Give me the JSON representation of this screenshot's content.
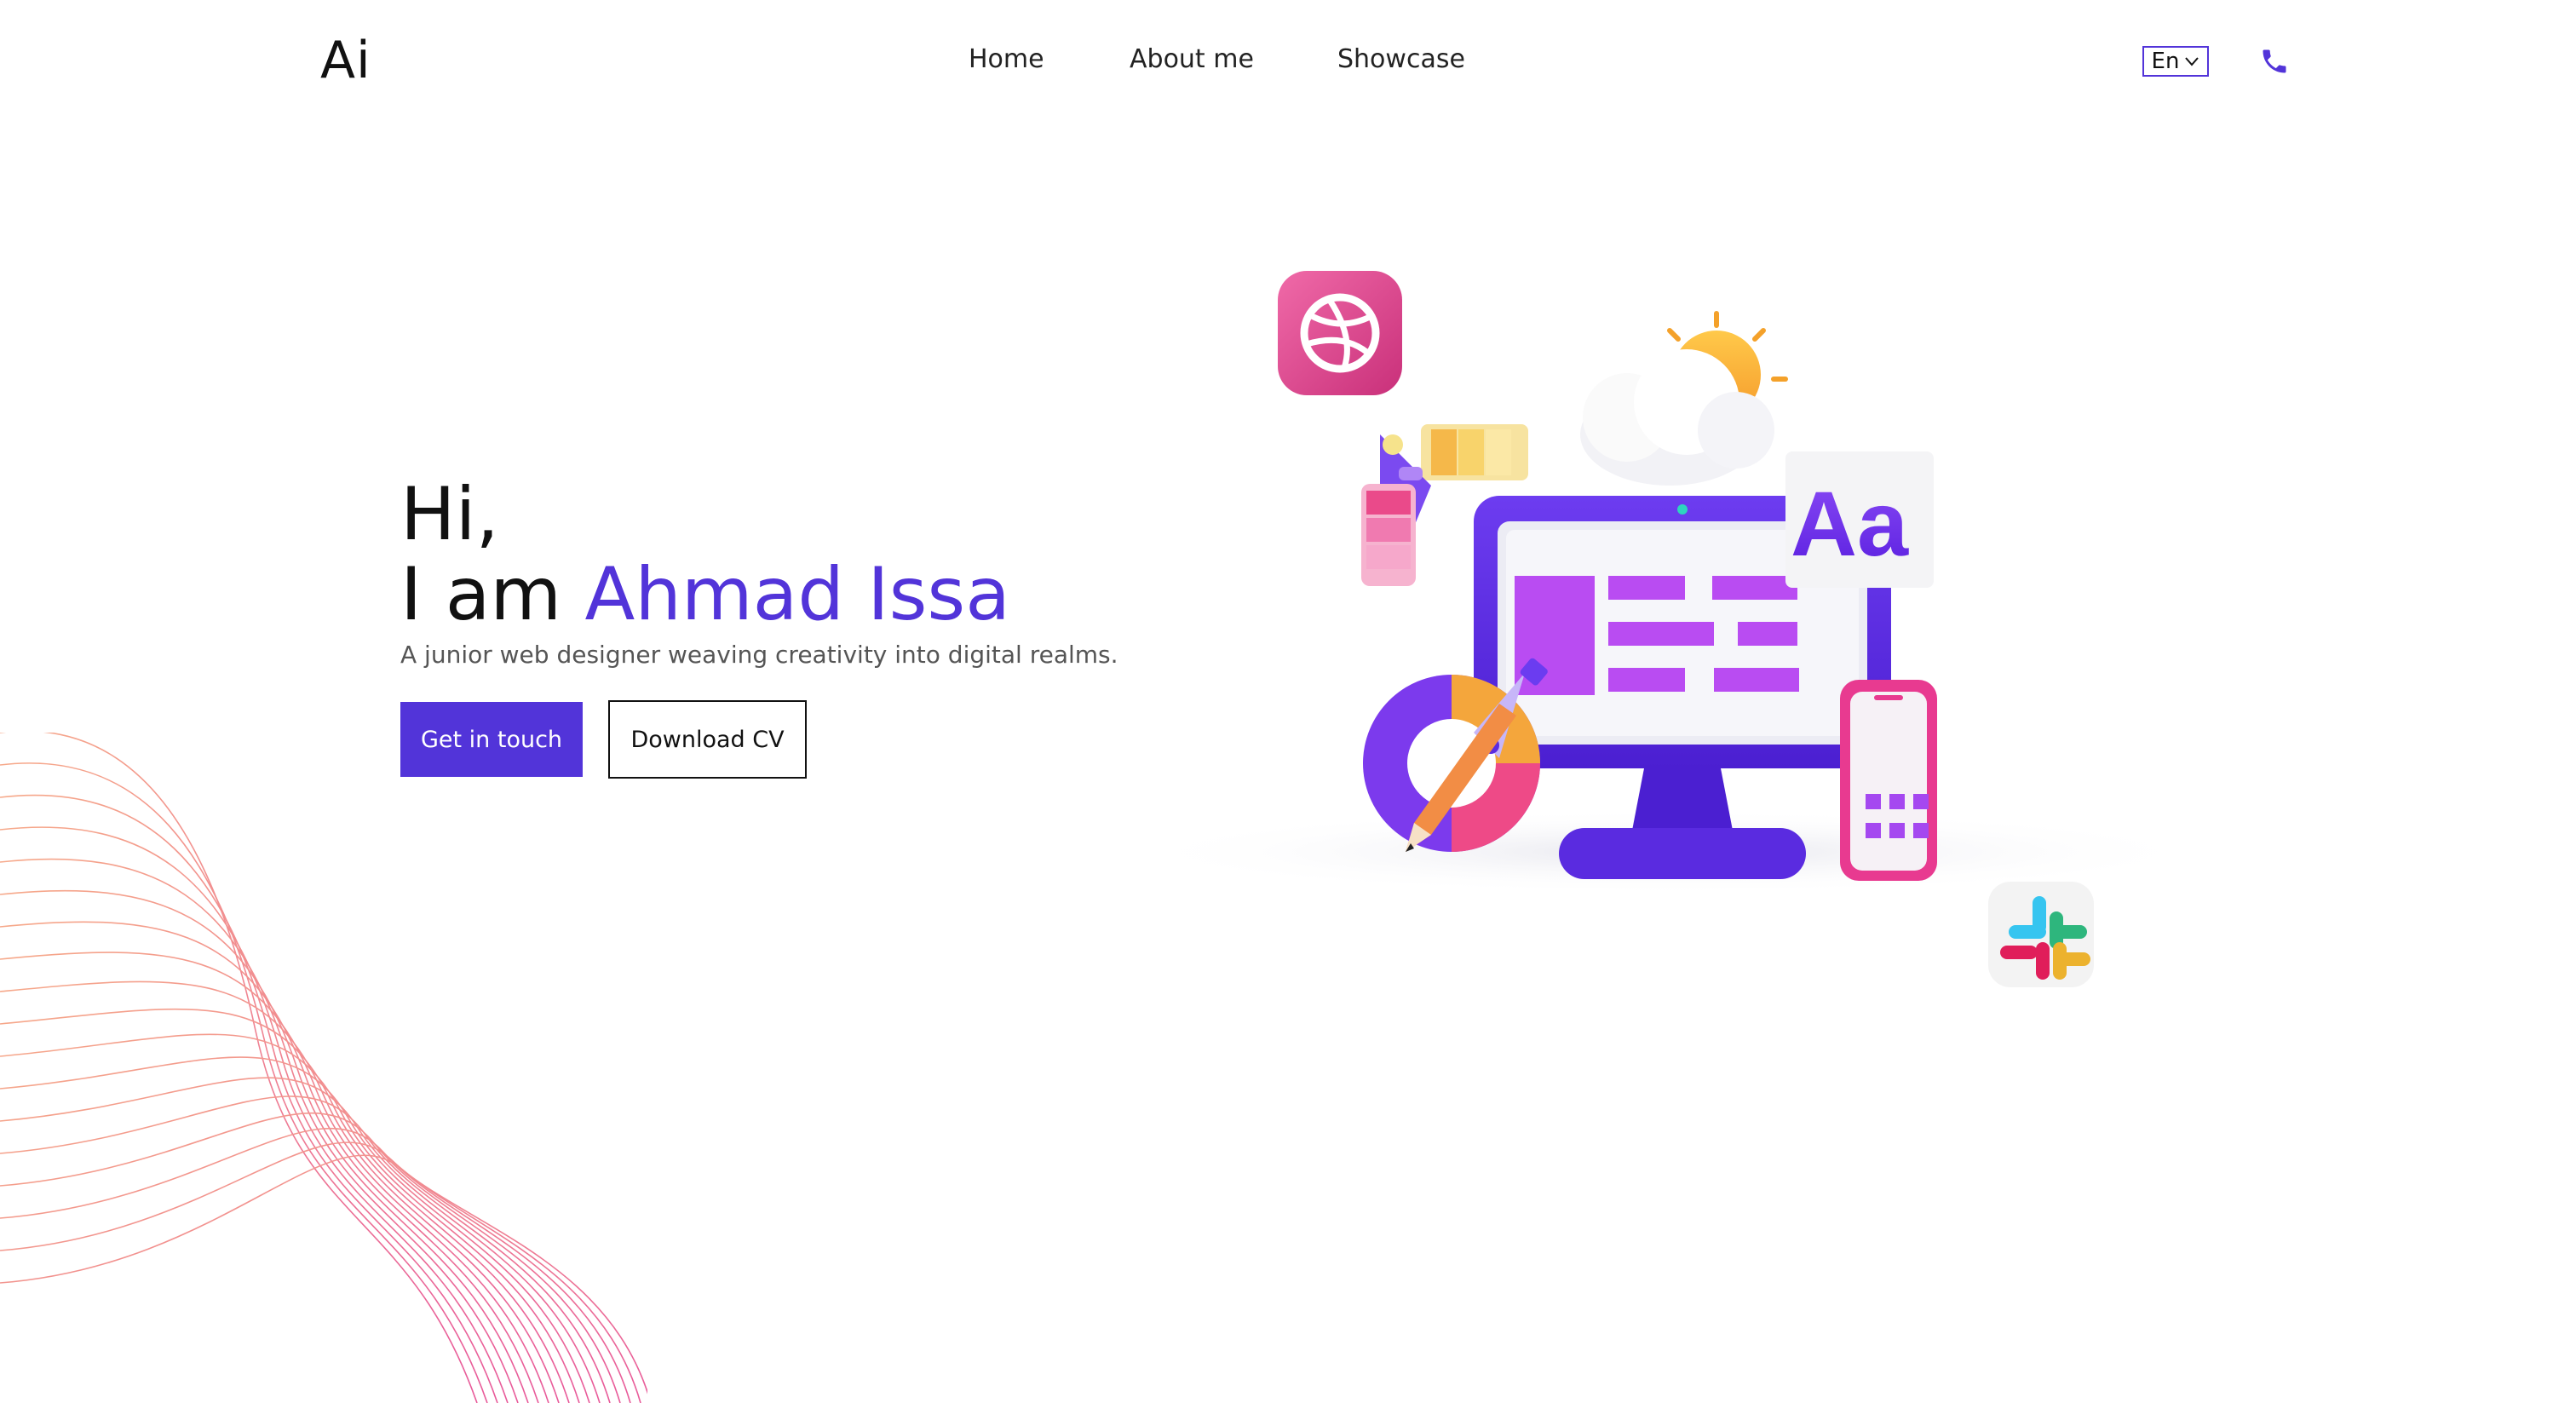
{
  "header": {
    "logo": "Ai",
    "nav": [
      {
        "label": "Home"
      },
      {
        "label": "About me"
      },
      {
        "label": "Showcase"
      }
    ],
    "language": "En",
    "phone_icon": "phone-icon"
  },
  "hero": {
    "greeting": "Hi,",
    "intro": "I am ",
    "name": "Ahmad Issa",
    "tagline": "A junior web designer weaving creativity into digital realms.",
    "primary_button": "Get in touch",
    "secondary_button": "Download CV"
  },
  "illustration": {
    "text": "Aa",
    "icons": [
      "dribbble-icon",
      "slack-icon",
      "sun-icon",
      "cloud-icon",
      "monitor-icon",
      "smartphone-icon",
      "pen-tool-icon",
      "pencil-icon",
      "color-swatch-icon"
    ]
  },
  "colors": {
    "accent": "#5234d9",
    "text": "#111111",
    "muted": "#555555",
    "wave_start": "#f6a98a",
    "wave_end": "#e85a9a"
  }
}
